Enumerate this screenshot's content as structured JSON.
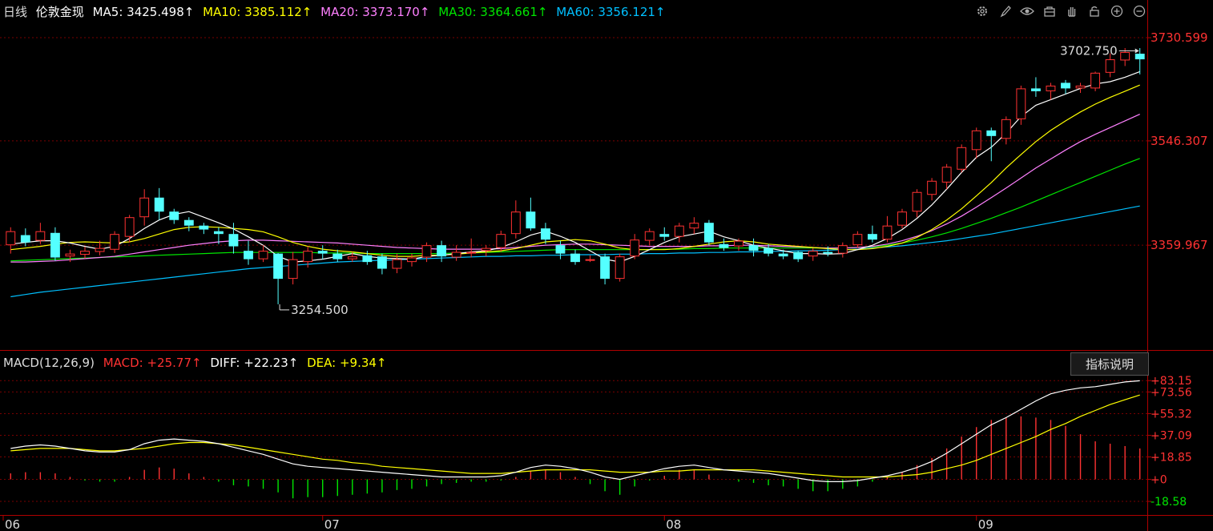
{
  "header": {
    "period": "日线",
    "symbol": "伦敦金现",
    "ma5": "MA5: 3425.498↑",
    "ma10": "MA10: 3385.112↑",
    "ma20": "MA20: 3373.170↑",
    "ma30": "MA30: 3364.661↑",
    "ma60": "MA60: 3356.121↑"
  },
  "toolbar": {
    "icons": [
      "gear-icon",
      "brush-icon",
      "eye-icon",
      "toolbox-icon",
      "hand-icon",
      "lock-icon",
      "zoom-in-icon",
      "zoom-out-icon"
    ]
  },
  "macd_header": {
    "name": "MACD(12,26,9)",
    "macd": "MACD: +25.77↑",
    "diff": "DIFF: +22.23↑",
    "dea": "DEA: +9.34↑",
    "explain_button": "指标说明"
  },
  "colors": {
    "up": "#ff3232",
    "down": "#54ffff",
    "ma5": "#ffffff",
    "ma10": "#ffff00",
    "ma20": "#ff80ff",
    "ma30": "#00e600",
    "ma60": "#00c0ff",
    "axis": "#b00000"
  },
  "chart_data": [
    {
      "type": "candlestick",
      "price_labels": [
        "3730.599",
        "3546.307",
        "3359.967"
      ],
      "price_ticks": [
        3730.599,
        3546.307,
        3359.967
      ],
      "ylim": [
        3180,
        3755
      ],
      "month_labels": [
        "06",
        "07",
        "08",
        "09"
      ],
      "month_index": [
        0,
        21,
        44,
        65
      ],
      "high_annotation": {
        "index": 76,
        "value": 3702.75,
        "label": "3702.750"
      },
      "low_annotation": {
        "index": 18,
        "value": 3254.5,
        "label": "3254.500"
      },
      "candles": [
        [
          3360,
          3385,
          3345,
          3392
        ],
        [
          3378,
          3365,
          3358,
          3390
        ],
        [
          3368,
          3385,
          3362,
          3400
        ],
        [
          3382,
          3338,
          3332,
          3392
        ],
        [
          3340,
          3345,
          3330,
          3352
        ],
        [
          3343,
          3350,
          3336,
          3357
        ],
        [
          3348,
          3355,
          3342,
          3368
        ],
        [
          3352,
          3380,
          3346,
          3385
        ],
        [
          3375,
          3410,
          3365,
          3414
        ],
        [
          3410,
          3445,
          3395,
          3460
        ],
        [
          3445,
          3420,
          3405,
          3462
        ],
        [
          3420,
          3405,
          3398,
          3425
        ],
        [
          3405,
          3395,
          3385,
          3410
        ],
        [
          3395,
          3388,
          3380,
          3400
        ],
        [
          3385,
          3380,
          3362,
          3392
        ],
        [
          3380,
          3358,
          3345,
          3400
        ],
        [
          3350,
          3335,
          3325,
          3368
        ],
        [
          3335,
          3350,
          3330,
          3360
        ],
        [
          3345,
          3300,
          3254.5,
          3346
        ],
        [
          3300,
          3335,
          3290,
          3348
        ],
        [
          3330,
          3350,
          3320,
          3358
        ],
        [
          3350,
          3345,
          3335,
          3360
        ],
        [
          3345,
          3335,
          3330,
          3352
        ],
        [
          3335,
          3340,
          3330,
          3348
        ],
        [
          3342,
          3330,
          3325,
          3350
        ],
        [
          3340,
          3318,
          3308,
          3345
        ],
        [
          3318,
          3335,
          3310,
          3345
        ],
        [
          3330,
          3338,
          3322,
          3345
        ],
        [
          3338,
          3360,
          3330,
          3365
        ],
        [
          3360,
          3340,
          3330,
          3368
        ],
        [
          3338,
          3348,
          3332,
          3360
        ],
        [
          3345,
          3348,
          3338,
          3372
        ],
        [
          3350,
          3355,
          3340,
          3360
        ],
        [
          3355,
          3380,
          3348,
          3386
        ],
        [
          3380,
          3420,
          3372,
          3440
        ],
        [
          3420,
          3390,
          3386,
          3445
        ],
        [
          3390,
          3370,
          3362,
          3400
        ],
        [
          3360,
          3345,
          3335,
          3368
        ],
        [
          3345,
          3330,
          3325,
          3352
        ],
        [
          3335,
          3335,
          3330,
          3342
        ],
        [
          3340,
          3300,
          3290,
          3345
        ],
        [
          3300,
          3340,
          3295,
          3345
        ],
        [
          3340,
          3370,
          3335,
          3380
        ],
        [
          3368,
          3385,
          3360,
          3390
        ],
        [
          3380,
          3375,
          3368,
          3392
        ],
        [
          3375,
          3395,
          3365,
          3400
        ],
        [
          3390,
          3400,
          3380,
          3410
        ],
        [
          3400,
          3365,
          3360,
          3405
        ],
        [
          3362,
          3355,
          3350,
          3372
        ],
        [
          3358,
          3368,
          3350,
          3372
        ],
        [
          3360,
          3350,
          3340,
          3372
        ],
        [
          3355,
          3345,
          3340,
          3362
        ],
        [
          3345,
          3340,
          3335,
          3352
        ],
        [
          3348,
          3335,
          3330,
          3350
        ],
        [
          3340,
          3350,
          3332,
          3355
        ],
        [
          3348,
          3345,
          3340,
          3358
        ],
        [
          3345,
          3360,
          3338,
          3365
        ],
        [
          3360,
          3380,
          3355,
          3385
        ],
        [
          3380,
          3370,
          3365,
          3395
        ],
        [
          3370,
          3395,
          3365,
          3412
        ],
        [
          3395,
          3420,
          3390,
          3425
        ],
        [
          3420,
          3455,
          3410,
          3460
        ],
        [
          3450,
          3475,
          3440,
          3480
        ],
        [
          3472,
          3500,
          3460,
          3505
        ],
        [
          3495,
          3535,
          3490,
          3540
        ],
        [
          3530,
          3565,
          3515,
          3570
        ],
        [
          3565,
          3555,
          3510,
          3570
        ],
        [
          3550,
          3585,
          3540,
          3590
        ],
        [
          3585,
          3640,
          3575,
          3645
        ],
        [
          3640,
          3635,
          3625,
          3660
        ],
        [
          3635,
          3645,
          3620,
          3650
        ],
        [
          3650,
          3640,
          3630,
          3655
        ],
        [
          3640,
          3645,
          3632,
          3650
        ],
        [
          3640,
          3668,
          3635,
          3670
        ],
        [
          3668,
          3692,
          3660,
          3702.75
        ],
        [
          3690,
          3705,
          3680,
          3712
        ],
        [
          3702,
          3692,
          3665,
          3712
        ]
      ],
      "ma5": [
        3362,
        3365,
        3368,
        3368,
        3364,
        3358,
        3353,
        3358,
        3372,
        3390,
        3405,
        3415,
        3420,
        3410,
        3400,
        3389,
        3375,
        3360,
        3340,
        3330,
        3332,
        3335,
        3340,
        3345,
        3340,
        3337,
        3336,
        3335,
        3340,
        3342,
        3345,
        3348,
        3350,
        3356,
        3366,
        3378,
        3385,
        3376,
        3365,
        3350,
        3335,
        3330,
        3340,
        3352,
        3365,
        3375,
        3380,
        3385,
        3375,
        3368,
        3360,
        3355,
        3350,
        3345,
        3345,
        3344,
        3345,
        3352,
        3360,
        3372,
        3388,
        3408,
        3432,
        3460,
        3490,
        3517,
        3535,
        3560,
        3590,
        3610,
        3620,
        3630,
        3640,
        3648,
        3652,
        3660,
        3670
      ],
      "ma10": [
        3352,
        3355,
        3358,
        3362,
        3365,
        3366,
        3365,
        3364,
        3366,
        3372,
        3380,
        3388,
        3392,
        3393,
        3392,
        3390,
        3388,
        3384,
        3375,
        3365,
        3358,
        3353,
        3350,
        3348,
        3345,
        3342,
        3340,
        3340,
        3342,
        3342,
        3344,
        3346,
        3348,
        3350,
        3354,
        3360,
        3366,
        3368,
        3370,
        3368,
        3362,
        3355,
        3352,
        3352,
        3352,
        3354,
        3358,
        3362,
        3366,
        3368,
        3366,
        3362,
        3360,
        3358,
        3356,
        3354,
        3352,
        3352,
        3354,
        3358,
        3364,
        3374,
        3388,
        3405,
        3425,
        3448,
        3472,
        3498,
        3522,
        3545,
        3565,
        3582,
        3598,
        3612,
        3624,
        3635,
        3646
      ],
      "ma20": [
        3330,
        3330,
        3331,
        3332,
        3334,
        3336,
        3338,
        3340,
        3344,
        3348,
        3352,
        3356,
        3360,
        3363,
        3366,
        3368,
        3369,
        3369,
        3368,
        3367,
        3366,
        3365,
        3364,
        3362,
        3360,
        3358,
        3356,
        3355,
        3354,
        3353,
        3353,
        3353,
        3353,
        3354,
        3356,
        3358,
        3360,
        3361,
        3362,
        3362,
        3361,
        3360,
        3359,
        3358,
        3358,
        3358,
        3358,
        3359,
        3359,
        3360,
        3360,
        3359,
        3358,
        3357,
        3356,
        3355,
        3355,
        3356,
        3358,
        3362,
        3368,
        3376,
        3386,
        3398,
        3412,
        3428,
        3445,
        3462,
        3480,
        3498,
        3514,
        3530,
        3545,
        3558,
        3570,
        3582,
        3594
      ],
      "ma30": [
        3332,
        3333,
        3334,
        3335,
        3336,
        3337,
        3338,
        3339,
        3340,
        3341,
        3342,
        3343,
        3344,
        3345,
        3346,
        3347,
        3347,
        3347,
        3347,
        3347,
        3347,
        3346,
        3346,
        3346,
        3345,
        3345,
        3345,
        3345,
        3345,
        3345,
        3346,
        3346,
        3347,
        3348,
        3349,
        3350,
        3351,
        3352,
        3352,
        3352,
        3352,
        3352,
        3352,
        3352,
        3353,
        3353,
        3354,
        3354,
        3355,
        3355,
        3355,
        3355,
        3355,
        3355,
        3355,
        3355,
        3355,
        3356,
        3357,
        3360,
        3364,
        3369,
        3375,
        3382,
        3390,
        3399,
        3408,
        3418,
        3428,
        3439,
        3450,
        3461,
        3472,
        3483,
        3494,
        3505,
        3515
      ],
      "ma60": [
        3268,
        3272,
        3276,
        3279,
        3282,
        3285,
        3288,
        3291,
        3294,
        3297,
        3300,
        3303,
        3306,
        3309,
        3312,
        3315,
        3318,
        3320,
        3322,
        3324,
        3326,
        3328,
        3330,
        3331,
        3332,
        3333,
        3334,
        3335,
        3336,
        3337,
        3338,
        3339,
        3340,
        3340,
        3341,
        3341,
        3342,
        3342,
        3343,
        3343,
        3343,
        3344,
        3344,
        3345,
        3345,
        3346,
        3346,
        3347,
        3347,
        3348,
        3348,
        3349,
        3349,
        3350,
        3350,
        3351,
        3352,
        3353,
        3355,
        3357,
        3359,
        3362,
        3365,
        3368,
        3372,
        3376,
        3380,
        3385,
        3390,
        3395,
        3400,
        3405,
        3410,
        3415,
        3420,
        3425,
        3430
      ]
    },
    {
      "type": "macd",
      "tick_labels": [
        "+83.15",
        "+73.56",
        "+55.32",
        "+37.09",
        "+18.85",
        "+0",
        "-18.58"
      ],
      "tick_values": [
        83.15,
        73.56,
        55.32,
        37.09,
        18.85,
        0,
        -18.58
      ],
      "ylim": [
        -28,
        88
      ],
      "diff": [
        26,
        28,
        29,
        28,
        26,
        24,
        23,
        23,
        25,
        30,
        33,
        34,
        33,
        32,
        30,
        27,
        24,
        21,
        17,
        13,
        11,
        10,
        9,
        8,
        7,
        6,
        5,
        4,
        3,
        2,
        2,
        2,
        2,
        3,
        6,
        10,
        12,
        11,
        9,
        6,
        2,
        0,
        3,
        6,
        9,
        11,
        12,
        10,
        8,
        7,
        6,
        5,
        3,
        1,
        -1,
        -2,
        -2,
        -1,
        1,
        3,
        6,
        10,
        15,
        22,
        30,
        38,
        46,
        52,
        59,
        66,
        72,
        75,
        77,
        78,
        80,
        82,
        83
      ],
      "dea": [
        24,
        25,
        26,
        26,
        26,
        25,
        24,
        24,
        25,
        26,
        28,
        30,
        31,
        31,
        30,
        29,
        27,
        25,
        23,
        21,
        19,
        17,
        16,
        14,
        13,
        11,
        10,
        9,
        8,
        7,
        6,
        5,
        5,
        5,
        6,
        7,
        8,
        8,
        8,
        8,
        7,
        6,
        6,
        6,
        7,
        7,
        8,
        8,
        8,
        8,
        8,
        7,
        6,
        5,
        4,
        3,
        2,
        2,
        2,
        2,
        3,
        4,
        6,
        9,
        12,
        16,
        21,
        26,
        31,
        36,
        42,
        47,
        53,
        58,
        63,
        67,
        71
      ],
      "macd": [
        5,
        6,
        6,
        5,
        2,
        -1,
        -2,
        -2,
        2,
        8,
        10,
        9,
        5,
        2,
        -2,
        -5,
        -6,
        -8,
        -11,
        -16,
        -15,
        -15,
        -14,
        -13,
        -12,
        -11,
        -9,
        -8,
        -6,
        -4,
        -3,
        -2,
        -2,
        -1,
        2,
        7,
        8,
        6,
        2,
        -4,
        -10,
        -13,
        -6,
        -1,
        3,
        8,
        8,
        4,
        0,
        -2,
        -3,
        -5,
        -6,
        -8,
        -10,
        -10,
        -8,
        -6,
        -2,
        2,
        6,
        12,
        18,
        26,
        36,
        44,
        50,
        52,
        53,
        52,
        50,
        45,
        38,
        32,
        30,
        28,
        26
      ]
    }
  ]
}
